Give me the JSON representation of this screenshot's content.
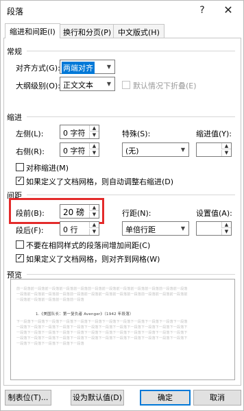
{
  "window": {
    "title": "段落",
    "help": "?",
    "close": "✕"
  },
  "tabs": [
    {
      "label": "缩进和间距(I)",
      "active": true
    },
    {
      "label": "换行和分页(P)",
      "active": false
    },
    {
      "label": "中文版式(H)",
      "active": false
    }
  ],
  "general": {
    "heading": "常规",
    "alignment_label": "对齐方式(G):",
    "alignment_value": "两端对齐",
    "outline_label": "大纲级别(O):",
    "outline_value": "正文文本",
    "collapse_label": "默认情况下折叠(E)",
    "collapse_checked": false
  },
  "indent": {
    "heading": "缩进",
    "left_label": "左侧(L):",
    "left_value": "0 字符",
    "right_label": "右侧(R):",
    "right_value": "0 字符",
    "special_label": "特殊(S):",
    "special_value": "(无)",
    "by_label": "缩进值(Y):",
    "by_value": "",
    "mirror_label": "对称缩进(M)",
    "mirror_checked": false,
    "auto_adjust_label": "如果定义了文档网格，则自动调整右缩进(D)",
    "auto_adjust_checked": true
  },
  "spacing": {
    "heading": "间距",
    "before_label": "段前(B):",
    "before_value": "20 磅",
    "after_label": "段后(F):",
    "after_value": "0 行",
    "line_label": "行距(N):",
    "line_value": "单倍行距",
    "at_label": "设置值(A):",
    "at_value": "",
    "no_space_label": "不要在相同样式的段落间增加间距(C)",
    "no_space_checked": false,
    "snap_grid_label": "如果定义了文档网格，则对齐到网格(W)",
    "snap_grid_checked": true
  },
  "preview": {
    "heading": "预览",
    "prev_para": [
      "前一段落前一段落前一段落前一段落前一段落前一段落前一段落前一段落前一段落前一段落前一段落前一段落",
      "一段落前一段落前一段落前一段落前一段落前一段落前一段落前一段落前一段落前一段落前一段落前一段落前",
      "一段落前一段落前一段落前一段落前一段落"
    ],
    "sample_text": "1.《美国队长：第一复仇者 Avenger》（1942 年段落）",
    "next_para": [
      "下一段落下一段落下一段落下一段落下一段落下一段落下一段落下一段落下一段落下一段落下一段落下一段落",
      "一段落下一段落下一段落下一段落下一段落下一段落下一段落下一段落下一段落下一段落下一段落下一段落下",
      "一段落下一段落下一段落下一段落下一段落下一段落下一段落下一段落下一段落下一段落下一段落下一段落下",
      "一段落下一段落下一段落下一段落下一段落下一段落下一段落下一段落下一段落下一段落下一段落下一段落下",
      "一段落下一段落下一段落下一段落下一段落"
    ]
  },
  "buttons": {
    "tabs": "制表位(T)...",
    "set_default": "设为默认值(D)",
    "ok": "确定",
    "cancel": "取消"
  },
  "colors": {
    "highlight_box": "#e32a2a",
    "selection": "#0078d7"
  }
}
